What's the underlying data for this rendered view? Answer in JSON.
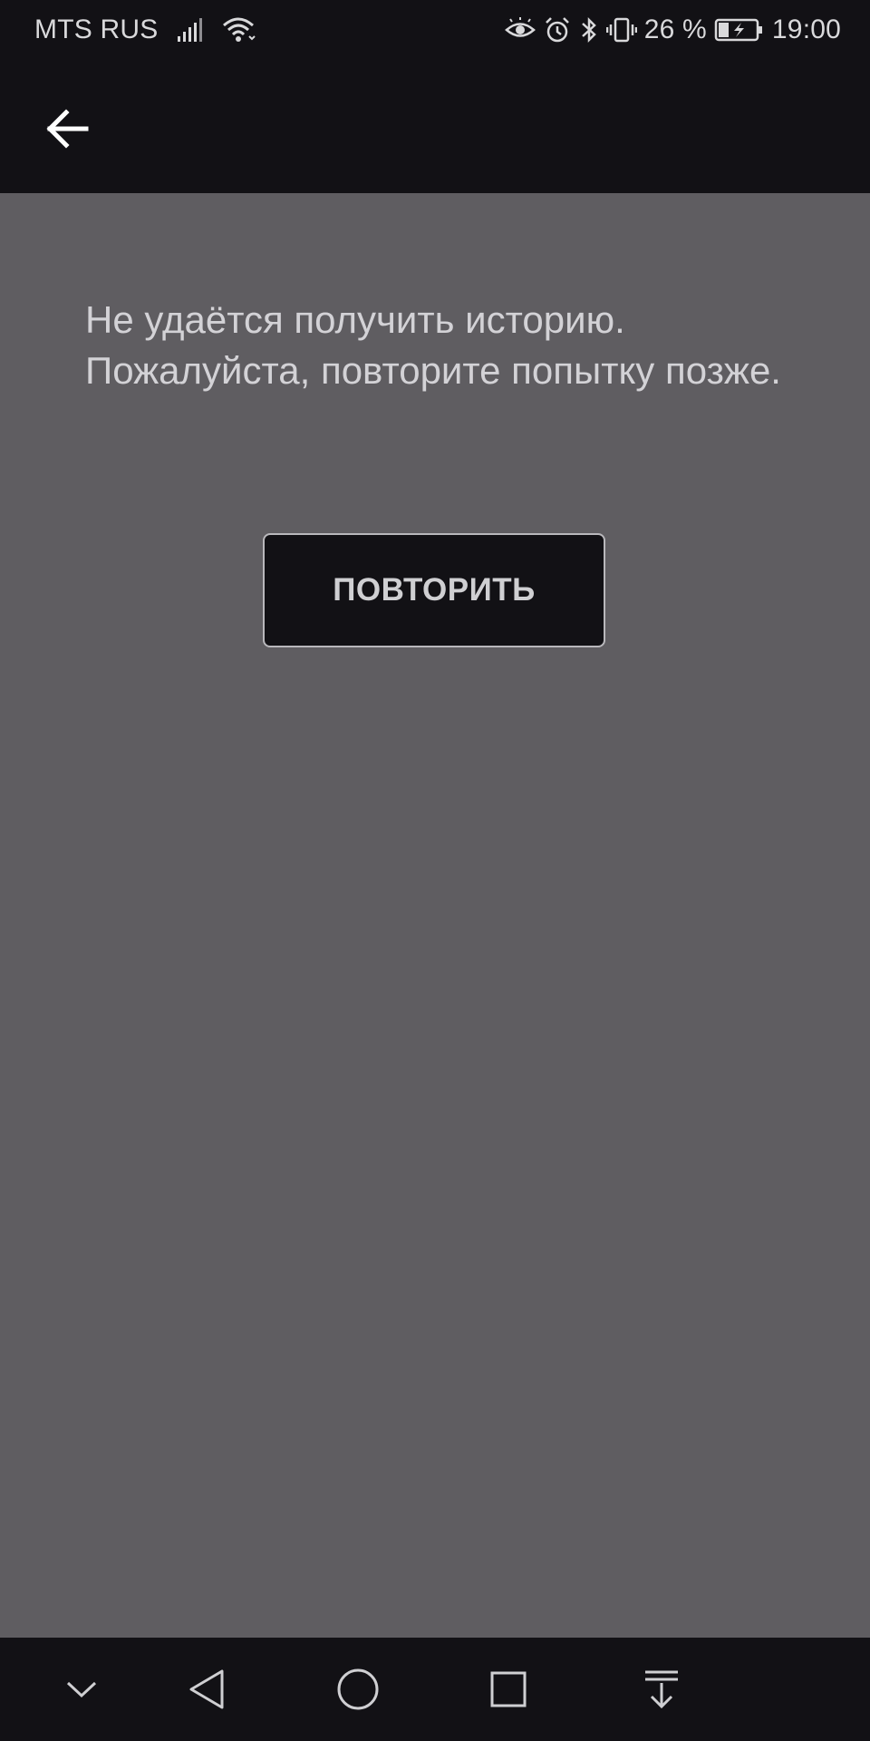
{
  "status_bar": {
    "carrier": "MTS RUS",
    "battery_percent": "26 %",
    "time": "19:00",
    "icons": [
      "signal-icon",
      "wifi-icon",
      "eye-icon",
      "alarm-icon",
      "bluetooth-icon",
      "vibrate-icon",
      "battery-charging-icon"
    ]
  },
  "app_bar": {
    "back_icon": "arrow-back-icon"
  },
  "content": {
    "error_message": "Не удаётся получить историю. Пожалуйста, повторите попытку позже.",
    "retry_label": "ПОВТОРИТЬ"
  },
  "nav_bar": {
    "icons": [
      "chevron-down-icon",
      "back-triangle-icon",
      "home-circle-icon",
      "recents-square-icon",
      "notification-pull-icon"
    ]
  },
  "colors": {
    "bar_background": "#121115",
    "content_background": "#5f5d61",
    "text": "#d3d2d6",
    "button_border": "#b9b8bc"
  }
}
